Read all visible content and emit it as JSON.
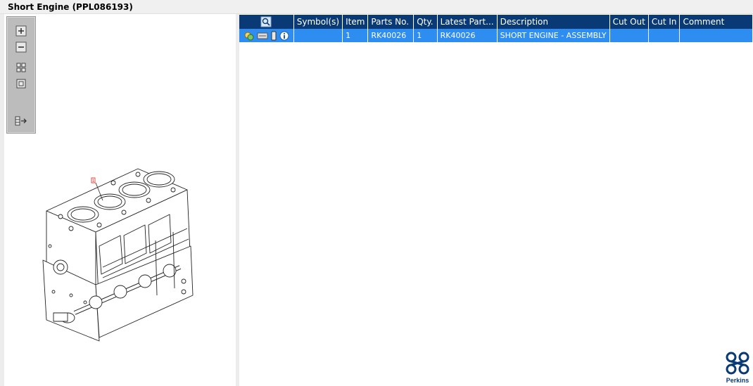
{
  "window": {
    "title": "Short Engine (PPL086193)"
  },
  "colors": {
    "header_bg": "#0a3a75",
    "selected_row_bg": "#2e8df1",
    "brand": "#0a3a75",
    "callout": "#e53935"
  },
  "toolbar": {
    "tools": [
      {
        "name": "zoom-in-icon"
      },
      {
        "name": "zoom-out-icon"
      },
      {
        "name": "fit-all-icon"
      },
      {
        "name": "fit-page-icon"
      },
      {
        "name": "toggle-list-icon"
      }
    ]
  },
  "drawing": {
    "callout_label": "1"
  },
  "table": {
    "headers": {
      "symbols": "Symbol(s)",
      "item": "Item",
      "parts_no": "Parts No.",
      "qty": "Qty.",
      "latest_part": "Latest Part...",
      "description": "Description",
      "cut_out": "Cut Out",
      "cut_in": "Cut In",
      "comment": "Comment"
    },
    "rows": [
      {
        "symbols": "",
        "item": "1",
        "parts_no": "RK40026",
        "qty": "1",
        "latest_part": "RK40026",
        "description": "SHORT ENGINE - ASSEMBLY",
        "cut_out": "",
        "cut_in": "",
        "comment": ""
      }
    ]
  },
  "brand": {
    "name": "Perkins"
  }
}
